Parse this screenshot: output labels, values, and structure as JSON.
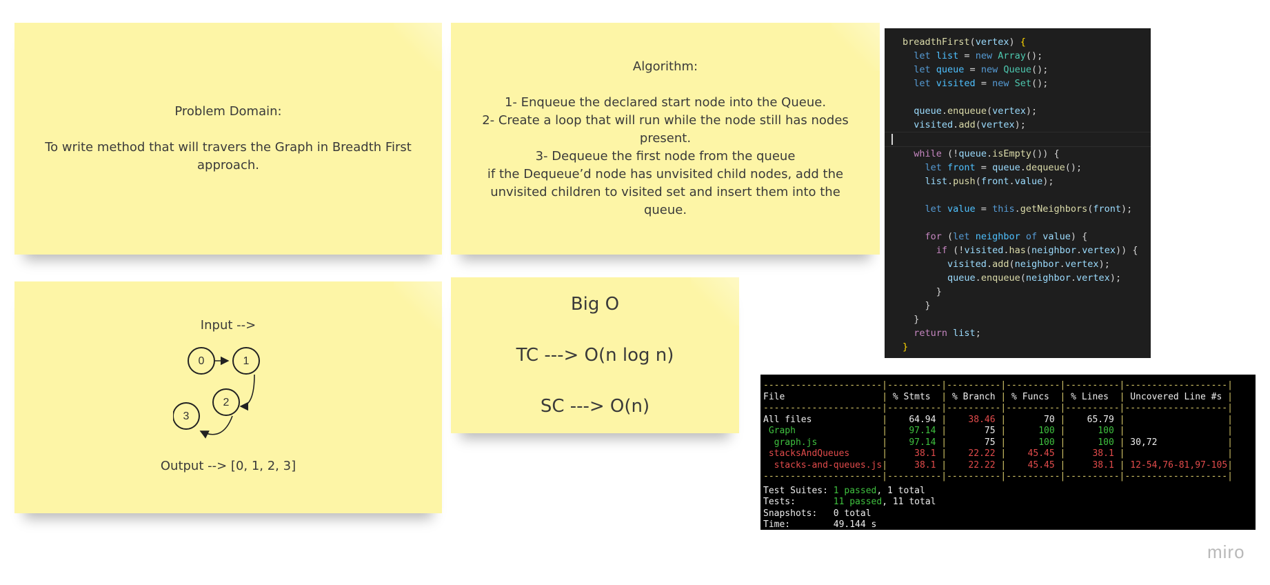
{
  "problem_domain": {
    "lines": [
      "Problem Domain:",
      "",
      "To write method that will travers the Graph in Breadth First approach."
    ]
  },
  "algorithm": {
    "lines": [
      "Algorithm:",
      "",
      "1- Enqueue the declared start node into the Queue.",
      "2- Create a loop that will run while the node still has nodes present.",
      "3- Dequeue the first node from the queue",
      "if the Dequeue’d node has unvisited child nodes, add the unvisited children to visited set and insert them into the queue."
    ]
  },
  "io": {
    "input_label": "Input -->",
    "output_label": "Output --> [0, 1, 2, 3]",
    "graph_nodes": [
      "0",
      "1",
      "2",
      "3"
    ]
  },
  "big_o": {
    "lines": [
      "Big O",
      "",
      "TC ---> O(n log n)",
      "",
      "SC ---> O(n)"
    ]
  },
  "code": {
    "lines": [
      [
        [
          "breadthFirst",
          "#dcdcaa"
        ],
        [
          "(",
          "#d4d4d4"
        ],
        [
          "vertex",
          "#9cdcfe"
        ],
        [
          ") ",
          "#d4d4d4"
        ],
        [
          "{",
          "#ffd700"
        ]
      ],
      [
        [
          "  ",
          "#d4d4d4"
        ],
        [
          "let ",
          "#569cd6"
        ],
        [
          "list",
          "#4fc1ff"
        ],
        [
          " = ",
          "#d4d4d4"
        ],
        [
          "new ",
          "#569cd6"
        ],
        [
          "Array",
          "#4ec9b0"
        ],
        [
          "();",
          "#d4d4d4"
        ]
      ],
      [
        [
          "  ",
          "#d4d4d4"
        ],
        [
          "let ",
          "#569cd6"
        ],
        [
          "queue",
          "#4fc1ff"
        ],
        [
          " = ",
          "#d4d4d4"
        ],
        [
          "new ",
          "#569cd6"
        ],
        [
          "Queue",
          "#4ec9b0"
        ],
        [
          "();",
          "#d4d4d4"
        ]
      ],
      [
        [
          "  ",
          "#d4d4d4"
        ],
        [
          "let ",
          "#569cd6"
        ],
        [
          "visited",
          "#4fc1ff"
        ],
        [
          " = ",
          "#d4d4d4"
        ],
        [
          "new ",
          "#569cd6"
        ],
        [
          "Set",
          "#4ec9b0"
        ],
        [
          "();",
          "#d4d4d4"
        ]
      ],
      [],
      [
        [
          "  ",
          "#d4d4d4"
        ],
        [
          "queue",
          "#9cdcfe"
        ],
        [
          ".",
          "#d4d4d4"
        ],
        [
          "enqueue",
          "#dcdcaa"
        ],
        [
          "(",
          "#d4d4d4"
        ],
        [
          "vertex",
          "#9cdcfe"
        ],
        [
          ");",
          "#d4d4d4"
        ]
      ],
      [
        [
          "  ",
          "#d4d4d4"
        ],
        [
          "visited",
          "#9cdcfe"
        ],
        [
          ".",
          "#d4d4d4"
        ],
        [
          "add",
          "#dcdcaa"
        ],
        [
          "(",
          "#d4d4d4"
        ],
        [
          "vertex",
          "#9cdcfe"
        ],
        [
          ");",
          "#d4d4d4"
        ]
      ],
      [],
      [
        [
          "  ",
          "#d4d4d4"
        ],
        [
          "while ",
          "#c586c0"
        ],
        [
          "(!",
          "#d4d4d4"
        ],
        [
          "queue",
          "#9cdcfe"
        ],
        [
          ".",
          "#d4d4d4"
        ],
        [
          "isEmpty",
          "#dcdcaa"
        ],
        [
          "()) {",
          "#d4d4d4"
        ]
      ],
      [
        [
          "    ",
          "#d4d4d4"
        ],
        [
          "let ",
          "#569cd6"
        ],
        [
          "front",
          "#4fc1ff"
        ],
        [
          " = ",
          "#d4d4d4"
        ],
        [
          "queue",
          "#9cdcfe"
        ],
        [
          ".",
          "#d4d4d4"
        ],
        [
          "dequeue",
          "#dcdcaa"
        ],
        [
          "();",
          "#d4d4d4"
        ]
      ],
      [
        [
          "    ",
          "#d4d4d4"
        ],
        [
          "list",
          "#9cdcfe"
        ],
        [
          ".",
          "#d4d4d4"
        ],
        [
          "push",
          "#dcdcaa"
        ],
        [
          "(",
          "#d4d4d4"
        ],
        [
          "front",
          "#9cdcfe"
        ],
        [
          ".",
          "#d4d4d4"
        ],
        [
          "value",
          "#9cdcfe"
        ],
        [
          ");",
          "#d4d4d4"
        ]
      ],
      [],
      [
        [
          "    ",
          "#d4d4d4"
        ],
        [
          "let ",
          "#569cd6"
        ],
        [
          "value",
          "#4fc1ff"
        ],
        [
          " = ",
          "#d4d4d4"
        ],
        [
          "this",
          "#569cd6"
        ],
        [
          ".",
          "#d4d4d4"
        ],
        [
          "getNeighbors",
          "#dcdcaa"
        ],
        [
          "(",
          "#d4d4d4"
        ],
        [
          "front",
          "#9cdcfe"
        ],
        [
          ");",
          "#d4d4d4"
        ]
      ],
      [],
      [
        [
          "    ",
          "#d4d4d4"
        ],
        [
          "for ",
          "#c586c0"
        ],
        [
          "(",
          "#d4d4d4"
        ],
        [
          "let ",
          "#569cd6"
        ],
        [
          "neighbor",
          "#4fc1ff"
        ],
        [
          " of ",
          "#569cd6"
        ],
        [
          "value",
          "#9cdcfe"
        ],
        [
          ") {",
          "#d4d4d4"
        ]
      ],
      [
        [
          "      ",
          "#d4d4d4"
        ],
        [
          "if ",
          "#c586c0"
        ],
        [
          "(!",
          "#d4d4d4"
        ],
        [
          "visited",
          "#9cdcfe"
        ],
        [
          ".",
          "#d4d4d4"
        ],
        [
          "has",
          "#dcdcaa"
        ],
        [
          "(",
          "#d4d4d4"
        ],
        [
          "neighbor",
          "#9cdcfe"
        ],
        [
          ".",
          "#d4d4d4"
        ],
        [
          "vertex",
          "#9cdcfe"
        ],
        [
          ")) {",
          "#d4d4d4"
        ]
      ],
      [
        [
          "        ",
          "#d4d4d4"
        ],
        [
          "visited",
          "#9cdcfe"
        ],
        [
          ".",
          "#d4d4d4"
        ],
        [
          "add",
          "#dcdcaa"
        ],
        [
          "(",
          "#d4d4d4"
        ],
        [
          "neighbor",
          "#9cdcfe"
        ],
        [
          ".",
          "#d4d4d4"
        ],
        [
          "vertex",
          "#9cdcfe"
        ],
        [
          ");",
          "#d4d4d4"
        ]
      ],
      [
        [
          "        ",
          "#d4d4d4"
        ],
        [
          "queue",
          "#9cdcfe"
        ],
        [
          ".",
          "#d4d4d4"
        ],
        [
          "enqueue",
          "#dcdcaa"
        ],
        [
          "(",
          "#d4d4d4"
        ],
        [
          "neighbor",
          "#9cdcfe"
        ],
        [
          ".",
          "#d4d4d4"
        ],
        [
          "vertex",
          "#9cdcfe"
        ],
        [
          ");",
          "#d4d4d4"
        ]
      ],
      [
        [
          "      }",
          "#d4d4d4"
        ]
      ],
      [
        [
          "    }",
          "#d4d4d4"
        ]
      ],
      [
        [
          "  }",
          "#d4d4d4"
        ]
      ],
      [
        [
          "  ",
          "#d4d4d4"
        ],
        [
          "return ",
          "#c586c0"
        ],
        [
          "list",
          "#9cdcfe"
        ],
        [
          ";",
          "#d4d4d4"
        ]
      ],
      [
        [
          "}",
          "#ffd700"
        ]
      ]
    ]
  },
  "coverage": {
    "separator": "----------------------|----------|----------|----------|----------|-------------------|",
    "header": [
      "File",
      "% Stmts",
      "% Branch",
      "% Funcs",
      "% Lines",
      "Uncovered Line #s"
    ],
    "rows": [
      {
        "file": "All files",
        "stmts": "64.94",
        "branch": "38.46",
        "funcs": "70",
        "lines": "65.79",
        "uncovered": "",
        "colors": [
          "white",
          "white",
          "red",
          "white",
          "white",
          "white"
        ]
      },
      {
        "file": " Graph",
        "stmts": "97.14",
        "branch": "75",
        "funcs": "100",
        "lines": "100",
        "uncovered": "",
        "colors": [
          "green",
          "green",
          "white",
          "green",
          "green",
          "white"
        ]
      },
      {
        "file": "  graph.js",
        "stmts": "97.14",
        "branch": "75",
        "funcs": "100",
        "lines": "100",
        "uncovered": "30,72",
        "colors": [
          "green",
          "green",
          "white",
          "green",
          "green",
          "white"
        ]
      },
      {
        "file": " stacksAndQueues",
        "stmts": "38.1",
        "branch": "22.22",
        "funcs": "45.45",
        "lines": "38.1",
        "uncovered": "",
        "colors": [
          "red",
          "red",
          "red",
          "red",
          "red",
          "red"
        ]
      },
      {
        "file": "  stacks-and-queues.js",
        "stmts": "38.1",
        "branch": "22.22",
        "funcs": "45.45",
        "lines": "38.1",
        "uncovered": "12-54,76-81,97-105",
        "colors": [
          "red",
          "red",
          "red",
          "red",
          "red",
          "red"
        ]
      }
    ],
    "summary": [
      {
        "label": "Test Suites: ",
        "parts": [
          [
            "1 passed",
            "green"
          ],
          [
            ", 1 total",
            "white"
          ]
        ]
      },
      {
        "label": "Tests:       ",
        "parts": [
          [
            "11 passed",
            "green"
          ],
          [
            ", 11 total",
            "white"
          ]
        ]
      },
      {
        "label": "Snapshots:   ",
        "parts": [
          [
            "0 total",
            "white"
          ]
        ]
      },
      {
        "label": "Time:        ",
        "parts": [
          [
            "49.144 s",
            "white"
          ]
        ]
      }
    ]
  },
  "branding": {
    "logo": "miro"
  },
  "colors": {
    "sticky": "#fdf5a6",
    "code_bg": "#1e1e1e",
    "terminal_bg": "#000000"
  }
}
